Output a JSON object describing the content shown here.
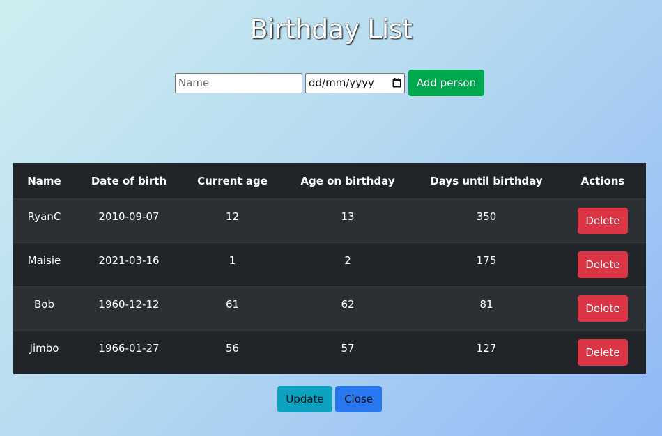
{
  "page": {
    "title": "Birthday List"
  },
  "form": {
    "name_placeholder": "Name",
    "name_value": "",
    "date_placeholder": "dd/mm/yyyy",
    "add_label": "Add person"
  },
  "table": {
    "headers": [
      "Name",
      "Date of birth",
      "Current age",
      "Age on birthday",
      "Days until birthday",
      "Actions"
    ],
    "rows": [
      {
        "name": "RyanC",
        "dob": "2010-09-07",
        "current_age": "12",
        "age_on_birthday": "13",
        "days_until": "350",
        "action": "Delete"
      },
      {
        "name": "Maisie",
        "dob": "2021-03-16",
        "current_age": "1",
        "age_on_birthday": "2",
        "days_until": "175",
        "action": "Delete"
      },
      {
        "name": "Bob",
        "dob": "1960-12-12",
        "current_age": "61",
        "age_on_birthday": "62",
        "days_until": "81",
        "action": "Delete"
      },
      {
        "name": "Jimbo",
        "dob": "1966-01-27",
        "current_age": "56",
        "age_on_birthday": "57",
        "days_until": "127",
        "action": "Delete"
      }
    ]
  },
  "footer": {
    "update_label": "Update",
    "close_label": "Close"
  },
  "colors": {
    "add_button": "#00a84f",
    "delete_button": "#dc3545",
    "update_button": "#0da2c0",
    "close_button": "#2a78f0",
    "table_bg": "#212529"
  },
  "icons": {
    "date_picker": "calendar-icon"
  }
}
